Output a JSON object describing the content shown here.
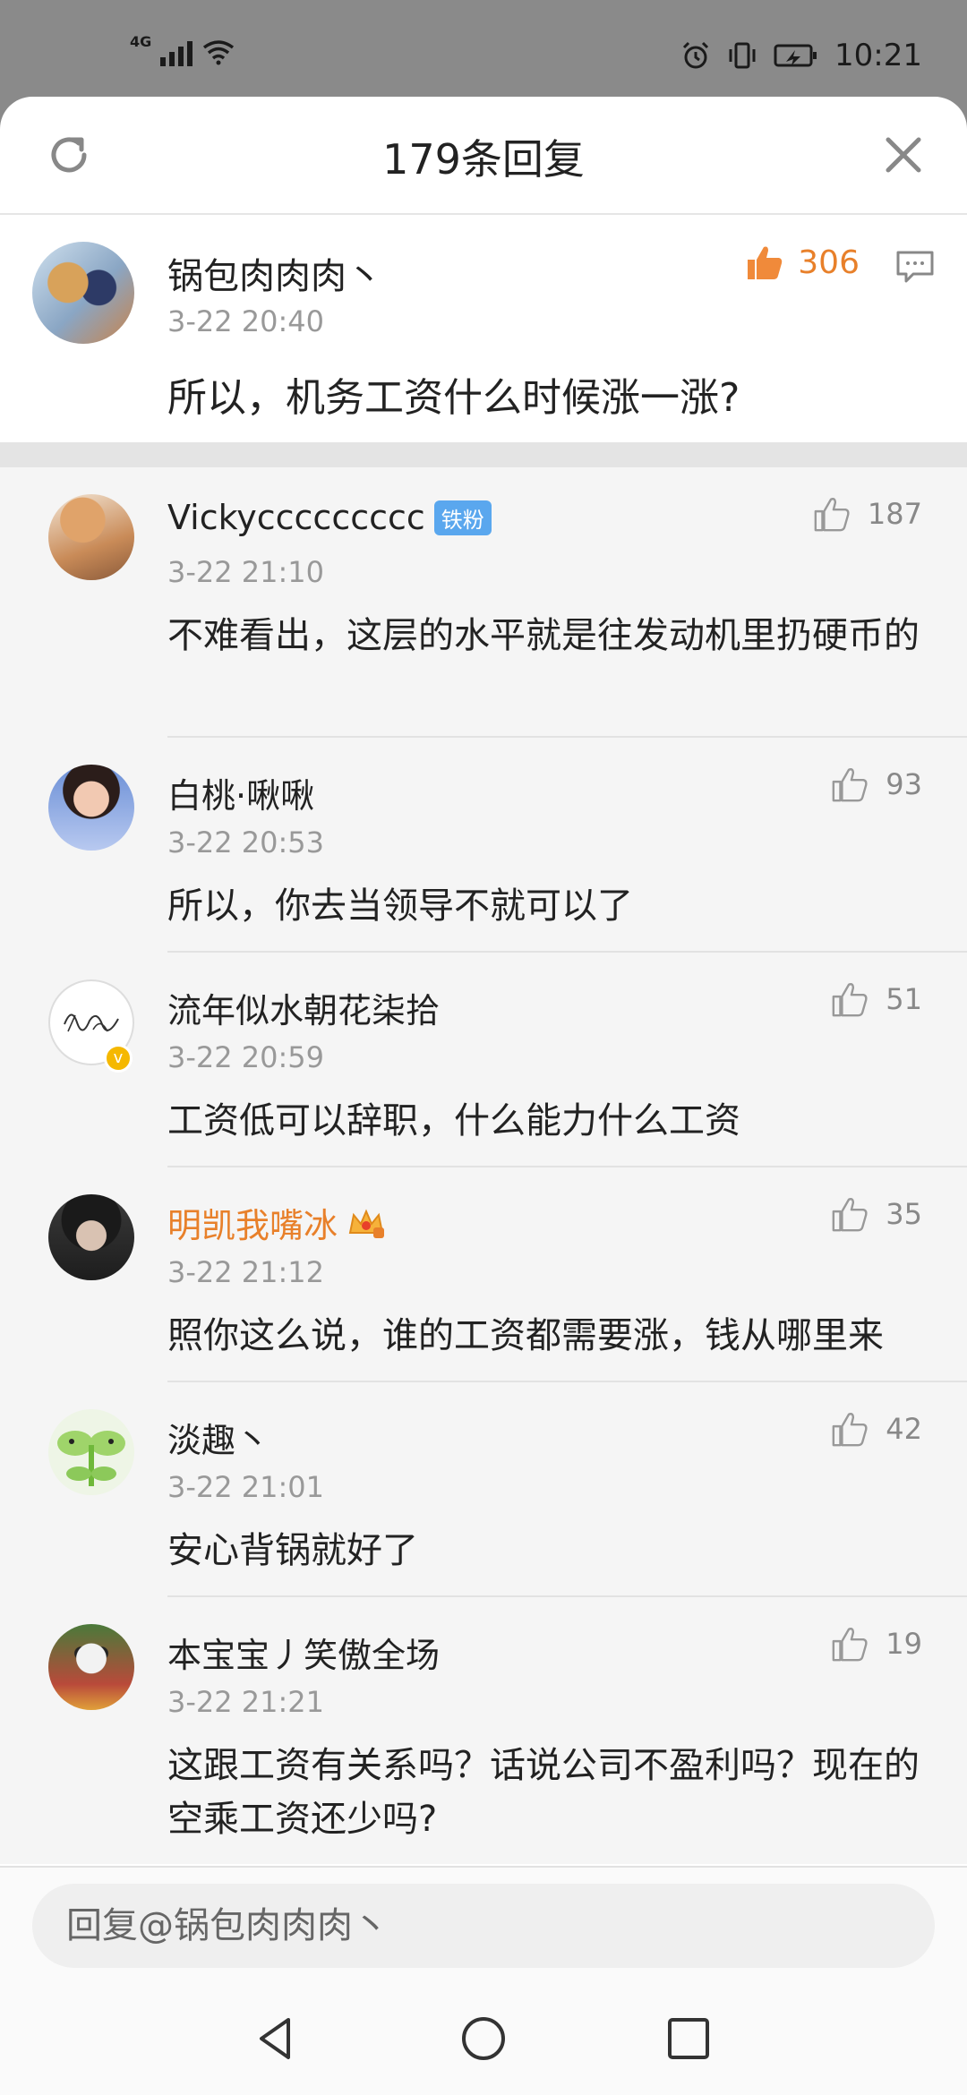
{
  "status_bar": {
    "network": "4G",
    "time": "10:21"
  },
  "header": {
    "title": "179条回复"
  },
  "root_comment": {
    "user": "锅包肉肉肉丶",
    "time": "3-22 20:40",
    "content": "所以，机务工资什么时候涨一涨?",
    "likes": "306"
  },
  "replies": [
    {
      "user": "Vickyccccccccc",
      "badge": "铁粉",
      "time": "3-22 21:10",
      "content": "不难看出，这层的水平就是往发动机里扔硬币的",
      "likes": "187"
    },
    {
      "user": "白桃·啾啾",
      "time": "3-22 20:53",
      "content": "所以，你去当领导不就可以了",
      "likes": "93"
    },
    {
      "user": "流年似水朝花柒拾",
      "time": "3-22 20:59",
      "content": "工资低可以辞职，什么能力什么工资",
      "likes": "51"
    },
    {
      "user": "明凯我嘴冰",
      "time": "3-22 21:12",
      "content": "照你这么说，谁的工资都需要涨，钱从哪里来",
      "likes": "35"
    },
    {
      "user": "淡趣丶",
      "time": "3-22 21:01",
      "content": "安心背锅就好了",
      "likes": "42"
    },
    {
      "user": "本宝宝丿笑傲全场",
      "time": "3-22 21:21",
      "content": "这跟工资有关系吗？话说公司不盈利吗？现在的空乘工资还少吗?",
      "likes": "19"
    }
  ],
  "reply_bar": {
    "placeholder": "回复@锅包肉肉肉丶"
  },
  "colors": {
    "accent": "#e8802a",
    "fan_badge": "#5aa7ee",
    "vip_orange": "#e8802a"
  }
}
